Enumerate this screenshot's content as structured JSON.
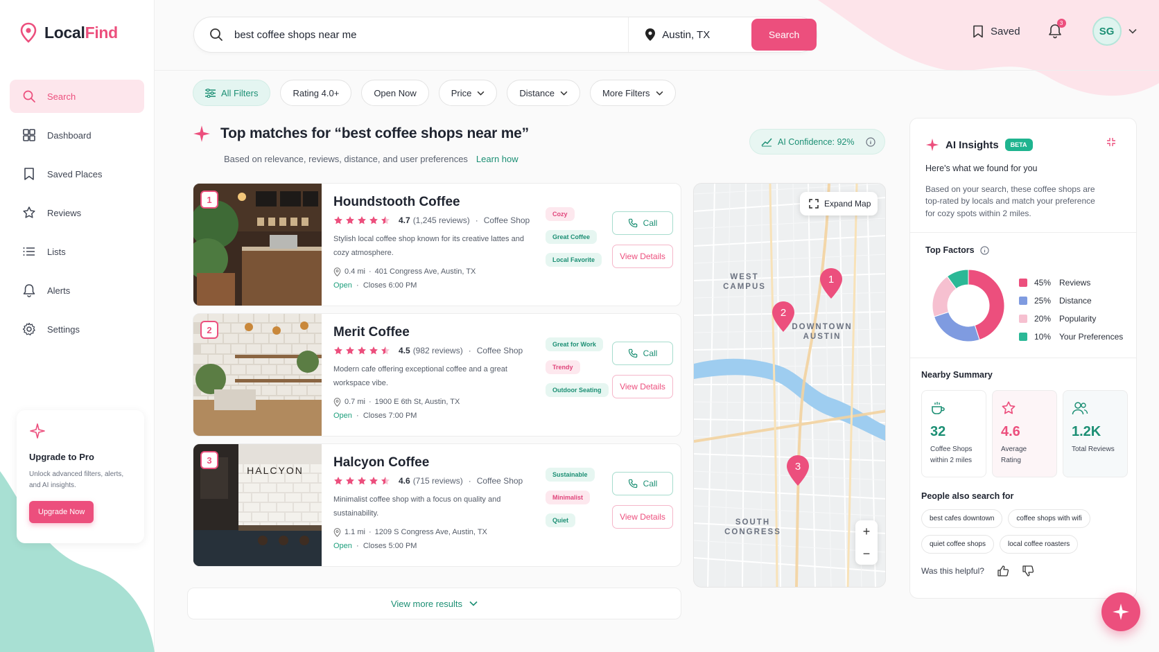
{
  "app": {
    "name_part1": "Local",
    "name_part2": "Find"
  },
  "sidebar": {
    "items": [
      {
        "label": "Search",
        "icon": "search-icon",
        "active": true
      },
      {
        "label": "Dashboard",
        "icon": "grid-icon"
      },
      {
        "label": "Saved Places",
        "icon": "bookmark-icon"
      },
      {
        "label": "Reviews",
        "icon": "star-icon"
      },
      {
        "label": "Lists",
        "icon": "list-icon"
      },
      {
        "label": "Alerts",
        "icon": "bell-icon"
      },
      {
        "label": "Settings",
        "icon": "gear-icon"
      }
    ],
    "upgrade": {
      "title": "Upgrade to Pro",
      "text": "Unlock advanced filters, alerts, and AI insights.",
      "button": "Upgrade Now"
    }
  },
  "search": {
    "query": "best coffee shops near me",
    "location": "Austin, TX",
    "button": "Search"
  },
  "header": {
    "saved_label": "Saved",
    "notif_count": "3",
    "avatar_initials": "SG"
  },
  "filters": [
    "All Filters",
    "Rating 4.0+",
    "Open Now",
    "Price",
    "Distance",
    "More Filters"
  ],
  "results": {
    "title": "Top matches for “best coffee shops near me”",
    "subtitle": "Based on relevance, reviews, distance, and user preferences",
    "learn_how": "Learn how",
    "confidence": "AI Confidence: 92%",
    "call_label": "Call",
    "details_label": "View Details",
    "view_more": "View more results",
    "items": [
      {
        "rank": "1",
        "name": "Houndstooth Coffee",
        "rating": "4.7",
        "reviews": "(1,245 reviews)",
        "category": "Coffee Shop",
        "stars": 4.5,
        "desc": "Stylish local coffee shop known for its creative lattes and cozy atmosphere.",
        "distance": "0.4 mi",
        "address": "401 Congress Ave, Austin, TX",
        "status": "Open",
        "closes": "Closes 6:00 PM",
        "tags": [
          {
            "t": "Cozy",
            "c": "pink"
          },
          {
            "t": "Great Coffee",
            "c": "green"
          },
          {
            "t": "Local Favorite",
            "c": "green"
          }
        ]
      },
      {
        "rank": "2",
        "name": "Merit Coffee",
        "rating": "4.5",
        "reviews": "(982 reviews)",
        "category": "Coffee Shop",
        "stars": 4.5,
        "desc": "Modern cafe offering exceptional coffee and a great workspace vibe.",
        "distance": "0.7 mi",
        "address": "1900 E 6th St, Austin, TX",
        "status": "Open",
        "closes": "Closes 7:00 PM",
        "tags": [
          {
            "t": "Great for Work",
            "c": "green"
          },
          {
            "t": "Trendy",
            "c": "pink"
          },
          {
            "t": "Outdoor Seating",
            "c": "green"
          }
        ]
      },
      {
        "rank": "3",
        "name": "Halcyon Coffee",
        "rating": "4.6",
        "reviews": "(715 reviews)",
        "category": "Coffee Shop",
        "stars": 4.5,
        "desc": "Minimalist coffee shop with a focus on quality and sustainability.",
        "distance": "1.1 mi",
        "address": "1209 S Congress Ave, Austin, TX",
        "status": "Open",
        "closes": "Closes 5:00 PM",
        "tags": [
          {
            "t": "Sustainable",
            "c": "green"
          },
          {
            "t": "Minimalist",
            "c": "pink"
          },
          {
            "t": "Quiet",
            "c": "green"
          }
        ]
      }
    ],
    "photo_sign": "HALCYON"
  },
  "map": {
    "expand_label": "Expand Map",
    "labels": {
      "west_campus": "WEST CAMPUS",
      "downtown": "DOWNTOWN AUSTIN",
      "south_congress": "SOUTH CONGRESS"
    },
    "pins": [
      "1",
      "2",
      "3"
    ]
  },
  "insights": {
    "title": "AI Insights",
    "beta": "BETA",
    "subtitle": "Here's what we found for you",
    "desc": "Based on your search, these coffee shops are top-rated by locals and match your preference for cozy spots within 2 miles.",
    "top_factors_title": "Top Factors",
    "factors": [
      {
        "pct": "45%",
        "label": "Reviews",
        "value": 45,
        "color": "#ec4f7d"
      },
      {
        "pct": "25%",
        "label": "Distance",
        "value": 25,
        "color": "#7f9be0"
      },
      {
        "pct": "20%",
        "label": "Popularity",
        "value": 20,
        "color": "#f6c0d0"
      },
      {
        "pct": "10%",
        "label": "Your Preferences",
        "value": 10,
        "color": "#2bb896"
      }
    ],
    "nearby_title": "Nearby Summary",
    "nearby": [
      {
        "value": "32",
        "label1": "Coffee Shops",
        "label2": "within 2 miles",
        "color": "#1c8f74"
      },
      {
        "value": "4.6",
        "label1": "Average Rating",
        "label2": "",
        "color": "#ec4f7d"
      },
      {
        "value": "1.2K",
        "label1": "Total Reviews",
        "label2": "",
        "color": "#1c8f74"
      }
    ],
    "also_title": "People also search for",
    "also": [
      "best cafes downtown",
      "coffee shops with wifi",
      "quiet coffee shops",
      "local coffee roasters"
    ],
    "helpful": "Was this helpful?"
  },
  "colors": {
    "accent": "#ec4f7d",
    "teal": "#1c8f74"
  }
}
